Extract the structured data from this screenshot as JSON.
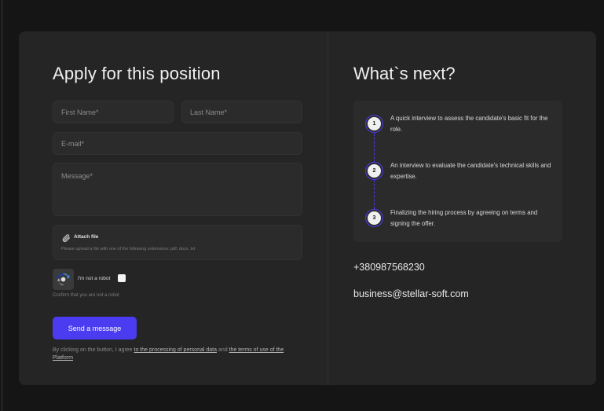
{
  "form": {
    "title": "Apply for this position",
    "first_name_placeholder": "First Name*",
    "last_name_placeholder": "Last Name*",
    "email_placeholder": "E-mail*",
    "message_placeholder": "Message*",
    "attach": {
      "label": "Attach file",
      "hint": "Please upload a file with one of the following extensions: pdf, docx, txt"
    },
    "captcha": {
      "label": "I'm not a robot",
      "hint": "Confirm that you are not a robot"
    },
    "send_label": "Send a message",
    "agreement": {
      "prefix": "By clicking on the button, I agree ",
      "link1": "to the processing of personal data",
      "middle": " and ",
      "link2": "the terms of use of the Platform"
    }
  },
  "next": {
    "title": "What`s next?",
    "steps": [
      {
        "num": "1",
        "text": "A quick interview to assess the candidate's basic fit for the role."
      },
      {
        "num": "2",
        "text": "An interview to evaluate the candidate's technical skills and expertise."
      },
      {
        "num": "3",
        "text": "Finalizing the hiring process by agreeing on terms and signing the offer."
      }
    ],
    "phone": "+380987568230",
    "email": "business@stellar-soft.com"
  },
  "colors": {
    "accent": "#4b3cf2",
    "card_bg": "#252525",
    "page_bg": "#151515"
  },
  "icons": [
    "paperclip-icon",
    "recaptcha-icon"
  ]
}
